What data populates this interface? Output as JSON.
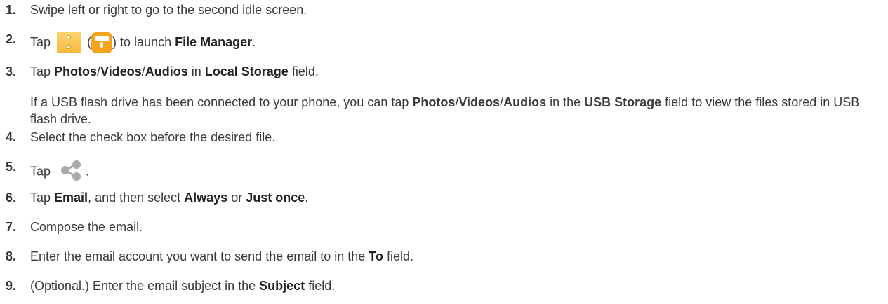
{
  "steps": [
    {
      "num": "1.",
      "parts": [
        {
          "t": "Swipe left or right to go to the second idle screen."
        }
      ]
    },
    {
      "num": "2.",
      "parts": [
        {
          "t": "Tap "
        },
        {
          "icon": "file-manager-icon"
        },
        {
          "t": " ("
        },
        {
          "icon": "file-manager-icon-alt"
        },
        {
          "t": ") to launch "
        },
        {
          "b": "File Manager"
        },
        {
          "t": "."
        }
      ]
    },
    {
      "num": "3.",
      "parts": [
        {
          "t": "Tap "
        },
        {
          "b": "Photos"
        },
        {
          "t": "/"
        },
        {
          "b": "Videos"
        },
        {
          "t": "/"
        },
        {
          "b": "Audios"
        },
        {
          "t": " in "
        },
        {
          "b": "Local Storage"
        },
        {
          "t": " field."
        }
      ]
    },
    {
      "num": "",
      "sub": true,
      "parts": [
        {
          "t": "If a USB flash drive has been connected to your phone, you can tap "
        },
        {
          "b": "Photos"
        },
        {
          "t": "/"
        },
        {
          "b": "Videos"
        },
        {
          "t": "/"
        },
        {
          "b": "Audios"
        },
        {
          "t": " in the "
        },
        {
          "b": "USB Storage"
        },
        {
          "t": " field to view the files stored in USB flash drive."
        }
      ]
    },
    {
      "num": "4.",
      "parts": [
        {
          "t": "Select the check box before the desired file."
        }
      ]
    },
    {
      "num": "5.",
      "parts": [
        {
          "t": "Tap "
        },
        {
          "icon": "share-icon"
        },
        {
          "t": " ."
        }
      ]
    },
    {
      "num": "6.",
      "parts": [
        {
          "t": "Tap "
        },
        {
          "b": "Email"
        },
        {
          "t": ", and then select "
        },
        {
          "b": "Always"
        },
        {
          "t": " or "
        },
        {
          "b": "Just once"
        },
        {
          "t": "."
        }
      ]
    },
    {
      "num": "7.",
      "parts": [
        {
          "t": "Compose the email."
        }
      ]
    },
    {
      "num": "8.",
      "parts": [
        {
          "t": "Enter the email account you want to send the email to in the "
        },
        {
          "b": "To"
        },
        {
          "t": " field."
        }
      ]
    },
    {
      "num": "9.",
      "parts": [
        {
          "t": "(Optional.) Enter the email subject in the "
        },
        {
          "b": "Subject"
        },
        {
          "t": " field."
        }
      ]
    }
  ]
}
